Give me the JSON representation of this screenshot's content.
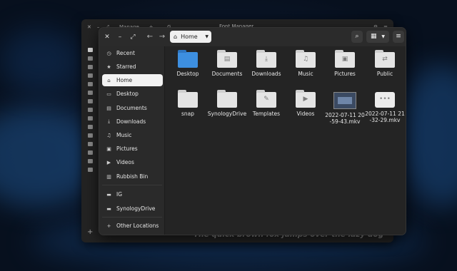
{
  "font_manager": {
    "title": "Font Manager",
    "tab_label": "Manage",
    "sample_text": "The quick brown fox jumps over the lazy dog"
  },
  "files": {
    "path_label": "Home",
    "sidebar": [
      {
        "label": "Recent",
        "icon": "clock-icon"
      },
      {
        "label": "Starred",
        "icon": "star-icon"
      },
      {
        "label": "Home",
        "icon": "home-icon",
        "selected": true
      },
      {
        "label": "Desktop",
        "icon": "desktop-icon"
      },
      {
        "label": "Documents",
        "icon": "document-icon"
      },
      {
        "label": "Downloads",
        "icon": "download-icon"
      },
      {
        "label": "Music",
        "icon": "music-icon"
      },
      {
        "label": "Pictures",
        "icon": "picture-icon"
      },
      {
        "label": "Videos",
        "icon": "video-icon"
      },
      {
        "label": "Rubbish Bin",
        "icon": "trash-icon"
      },
      {
        "label": "IG",
        "icon": "drive-icon"
      },
      {
        "label": "SynologyDrive",
        "icon": "drive-icon"
      },
      {
        "label": "Other Locations",
        "icon": "plus-icon"
      }
    ],
    "items": [
      {
        "label": "Desktop",
        "kind": "folder-blue"
      },
      {
        "label": "Documents",
        "kind": "folder"
      },
      {
        "label": "Downloads",
        "kind": "folder"
      },
      {
        "label": "Music",
        "kind": "folder"
      },
      {
        "label": "Pictures",
        "kind": "folder"
      },
      {
        "label": "Public",
        "kind": "folder"
      },
      {
        "label": "snap",
        "kind": "folder"
      },
      {
        "label": "SynologyDrive",
        "kind": "folder"
      },
      {
        "label": "Templates",
        "kind": "folder"
      },
      {
        "label": "Videos",
        "kind": "folder"
      },
      {
        "label": "2022-07-11 20-59-43.mkv",
        "kind": "video-thumb"
      },
      {
        "label": "2022-07-11 21-32-29.mkv",
        "kind": "video-generic"
      }
    ]
  }
}
